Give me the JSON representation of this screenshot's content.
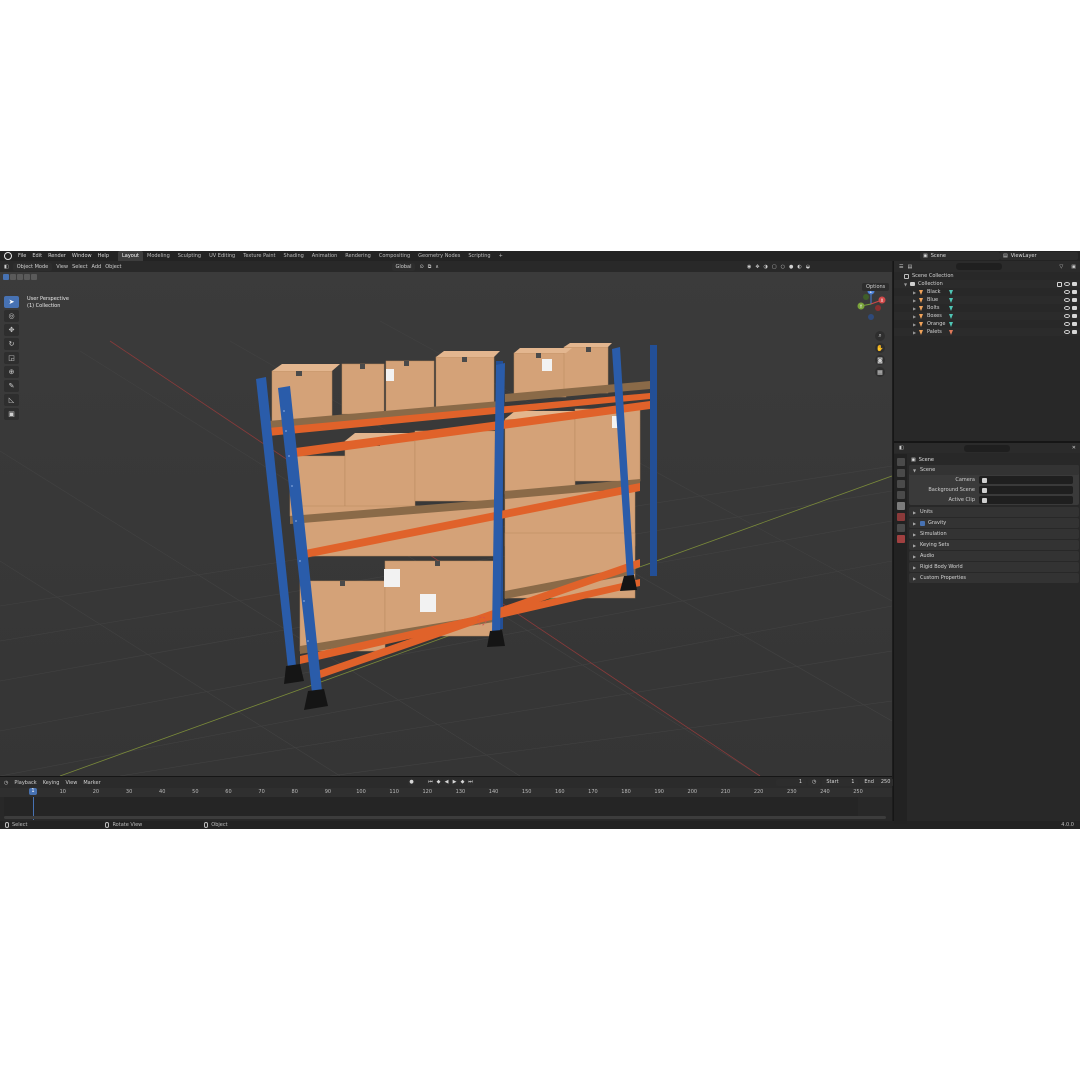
{
  "topbar": {
    "menus": [
      "File",
      "Edit",
      "Render",
      "Window",
      "Help"
    ],
    "workspaces": [
      "Layout",
      "Modeling",
      "Sculpting",
      "UV Editing",
      "Texture Paint",
      "Shading",
      "Animation",
      "Rendering",
      "Compositing",
      "Geometry Nodes",
      "Scripting"
    ],
    "active_workspace": "Layout",
    "add_tab": "+",
    "scene": "Scene",
    "view_layer": "ViewLayer"
  },
  "viewport": {
    "mode": "Object Mode",
    "menus": [
      "View",
      "Select",
      "Add",
      "Object"
    ],
    "transform_orientation": "Global",
    "options_label": "Options",
    "overlay_line1": "User Perspective",
    "overlay_line2": "(1) Collection",
    "gizmo": {
      "x": "X",
      "y": "Y",
      "z": "Z"
    }
  },
  "timeline": {
    "menus": [
      "Playback",
      "Keying",
      "View",
      "Marker"
    ],
    "current_frame": "1",
    "start_label": "Start",
    "start": "1",
    "end_label": "End",
    "end": "250",
    "ticks": [
      1,
      10,
      20,
      30,
      40,
      50,
      60,
      70,
      80,
      90,
      100,
      110,
      120,
      130,
      140,
      150,
      160,
      170,
      180,
      190,
      200,
      210,
      220,
      230,
      240,
      250
    ]
  },
  "statusbar": {
    "select": "Select",
    "rotate": "Rotate View",
    "object": "Object",
    "version": "4.0.0"
  },
  "outliner": {
    "scene_collection": "Scene Collection",
    "collection": "Collection",
    "objects": [
      "Black",
      "Blue",
      "Bolts",
      "Boxes",
      "Orange",
      "Palets"
    ]
  },
  "properties": {
    "title": "Scene",
    "scene_panel": "Scene",
    "camera_label": "Camera",
    "background_label": "Background Scene",
    "clip_label": "Active Clip",
    "panels": [
      "Units",
      "Gravity",
      "Simulation",
      "Keying Sets",
      "Audio",
      "Rigid Body World",
      "Custom Properties"
    ]
  },
  "colors": {
    "accent": "#4772b3",
    "rack_blue": "#2a5caa",
    "beam_orange": "#e0622a",
    "box": "#d9a77c",
    "pallet": "#8a6a48"
  }
}
